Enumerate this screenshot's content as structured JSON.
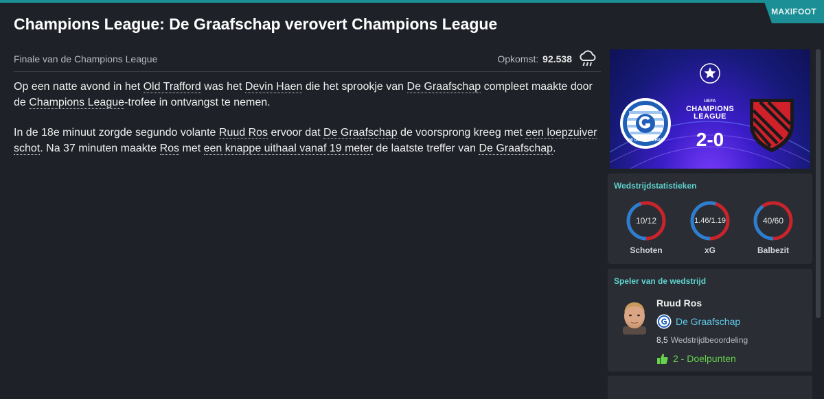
{
  "brand": "MAXIFOOT",
  "title": "Champions League: De Graafschap verovert Champions League",
  "subtitle": "Finale van de Champions League",
  "attendance": {
    "label": "Opkomst:",
    "value": "92.538",
    "weather_icon": "rain-cloud-icon"
  },
  "article": {
    "p1": [
      {
        "t": "Op een natte avond in het "
      },
      {
        "t": "Old Trafford",
        "link": true
      },
      {
        "t": " was het "
      },
      {
        "t": "Devin Haen",
        "link": true
      },
      {
        "t": " die het sprookje van "
      },
      {
        "t": "De Graafschap",
        "link": true
      },
      {
        "t": " compleet maakte door de "
      },
      {
        "t": "Champions League",
        "link": true
      },
      {
        "t": "-trofee in ontvangst te nemen."
      }
    ],
    "p2": [
      {
        "t": "In de 18e minuut zorgde segundo volante "
      },
      {
        "t": "Ruud Ros",
        "link": true
      },
      {
        "t": " ervoor dat "
      },
      {
        "t": "De Graafschap",
        "link": true
      },
      {
        "t": " de voorsprong kreeg met "
      },
      {
        "t": "een loepzuiver schot",
        "link": true
      },
      {
        "t": ". Na 37 minuten maakte "
      },
      {
        "t": "Ros",
        "link": true
      },
      {
        "t": " met "
      },
      {
        "t": "een knappe uithaal vanaf 19 meter",
        "link": true
      },
      {
        "t": " de laatste treffer van "
      },
      {
        "t": "De Graafschap",
        "link": true
      },
      {
        "t": "."
      }
    ]
  },
  "banner": {
    "competition_line1": "CHAMPIONS",
    "competition_line2": "LEAGUE",
    "uefa": "UEFA",
    "score": "2-0",
    "home_logo_text": "DE GRAAFSCHAP"
  },
  "match_stats": {
    "title": "Wedstrijdstatistieken",
    "items": [
      {
        "label": "Schoten",
        "value": "10/12",
        "home_share": 0.45
      },
      {
        "label": "xG",
        "value": "1.46/1.19",
        "home_share": 0.55
      },
      {
        "label": "Balbezit",
        "value": "40/60",
        "home_share": 0.4
      }
    ],
    "home_color": "#2a7fd1",
    "away_color": "#c9242c"
  },
  "potm": {
    "title": "Speler van de wedstrijd",
    "name": "Ruud Ros",
    "club": "De Graafschap",
    "rating": "8,5",
    "rating_label": "Wedstrijdbeoordeling",
    "goals": "2 - Doelpunten"
  }
}
